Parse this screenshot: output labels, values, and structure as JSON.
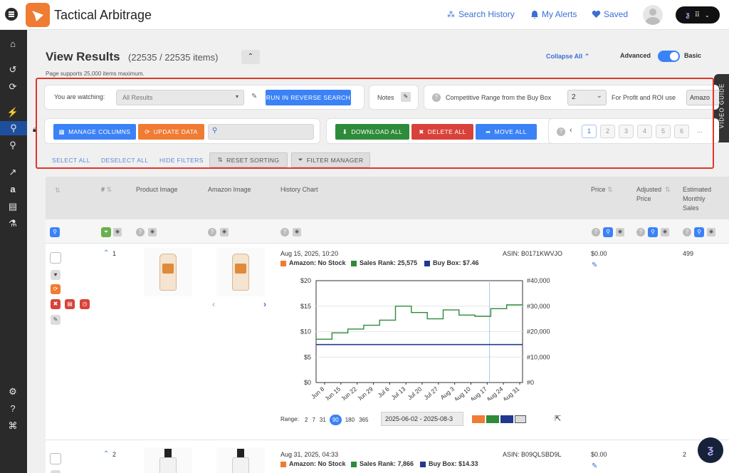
{
  "app": {
    "title": "Tactical Arbitrage"
  },
  "topnav": {
    "search_history": "Search History",
    "my_alerts": "My Alerts",
    "saved": "Saved"
  },
  "page": {
    "title": "View Results",
    "count": "(22535 / 22535 items)",
    "max_note": "Page supports 25,000 items maximum.",
    "collapse_all": "Collapse All",
    "advanced": "Advanced",
    "basic": "Basic",
    "video_guide": "VIDEO GUIDE"
  },
  "filters": {
    "watching_label": "You are watching:",
    "watching_value": "All Results",
    "reverse_search": "RUN IN REVERSE SEARCH",
    "notes": "Notes",
    "competitive_label": "Competitive Range from the Buy Box",
    "competitive_value": "2",
    "profit_label": "For Profit and ROI use",
    "profit_value": "Amazo",
    "manage_columns": "MANAGE COLUMNS",
    "update_data": "UPDATE DATA",
    "download_all": "DOWNLOAD ALL",
    "delete_all": "DELETE ALL",
    "move_all": "MOVE ALL",
    "pages": [
      "1",
      "2",
      "3",
      "4",
      "5",
      "6"
    ],
    "ellipsis": "...",
    "select_all": "SELECT ALL",
    "deselect_all": "DESELECT ALL",
    "hide_filters": "HIDE FILTERS",
    "reset_sorting": "RESET SORTING",
    "filter_manager": "FILTER MANAGER"
  },
  "columns": {
    "num": "#",
    "product_image": "Product Image",
    "amazon_image": "Amazon Image",
    "history_chart": "History Chart",
    "price": "Price",
    "adjusted_price": "Adjusted Price",
    "monthly_sales": "Estimated Monthly Sales"
  },
  "rows": [
    {
      "num": "1",
      "date": "Aug 15, 2025, 10:20",
      "asin": "ASIN: B0171KWVJO",
      "amazon": "Amazon: No Stock",
      "sales_rank": "Sales Rank: 25,575",
      "buy_box": "Buy Box: $7.46",
      "price": "$0.00",
      "sales": "499"
    },
    {
      "num": "2",
      "date": "Aug 31, 2025, 04:33",
      "asin": "ASIN: B09QLSBD9L",
      "amazon": "Amazon: No Stock",
      "sales_rank": "Sales Rank: 7,866",
      "buy_box": "Buy Box: $14.33",
      "price": "$0.00",
      "sales": "2"
    }
  ],
  "chart_controls": {
    "range_label": "Range:",
    "ranges": [
      "2",
      "7",
      "31",
      "90",
      "180",
      "365"
    ],
    "selected_range": "90",
    "date_range": "2025-06-02 - 2025-08-3"
  },
  "colors": {
    "amazon": "#f07b32",
    "sales_rank": "#2e8b3a",
    "buy_box": "#22388f",
    "accent": "#3b82f6"
  },
  "chart_data": {
    "type": "line",
    "title": "",
    "x": [
      "Jun 8",
      "Jun 15",
      "Jun 22",
      "Jun 29",
      "Jul 6",
      "Jul 13",
      "Jul 20",
      "Jul 27",
      "Aug 3",
      "Aug 10",
      "Aug 17",
      "Aug 24",
      "Aug 31"
    ],
    "left_axis": {
      "ticks": [
        "$0",
        "$5",
        "$10",
        "$15",
        "$20"
      ],
      "ylim": [
        0,
        20
      ]
    },
    "right_axis": {
      "ticks": [
        "#0",
        "#10,000",
        "#20,000",
        "#30,000",
        "#40,000"
      ],
      "ylim": [
        0,
        40000
      ]
    },
    "series": [
      {
        "name": "Sales Rank",
        "axis": "right",
        "values": [
          17000,
          19500,
          21000,
          22500,
          24500,
          30000,
          27500,
          25000,
          28500,
          26500,
          26000,
          29000,
          30500,
          31000
        ]
      },
      {
        "name": "Buy Box",
        "axis": "left",
        "values": [
          7.46,
          7.46,
          7.46,
          7.46,
          7.46,
          7.46,
          7.46,
          7.46,
          7.46,
          7.46,
          7.46,
          7.46,
          7.46,
          7.46
        ]
      }
    ],
    "grid": true
  }
}
